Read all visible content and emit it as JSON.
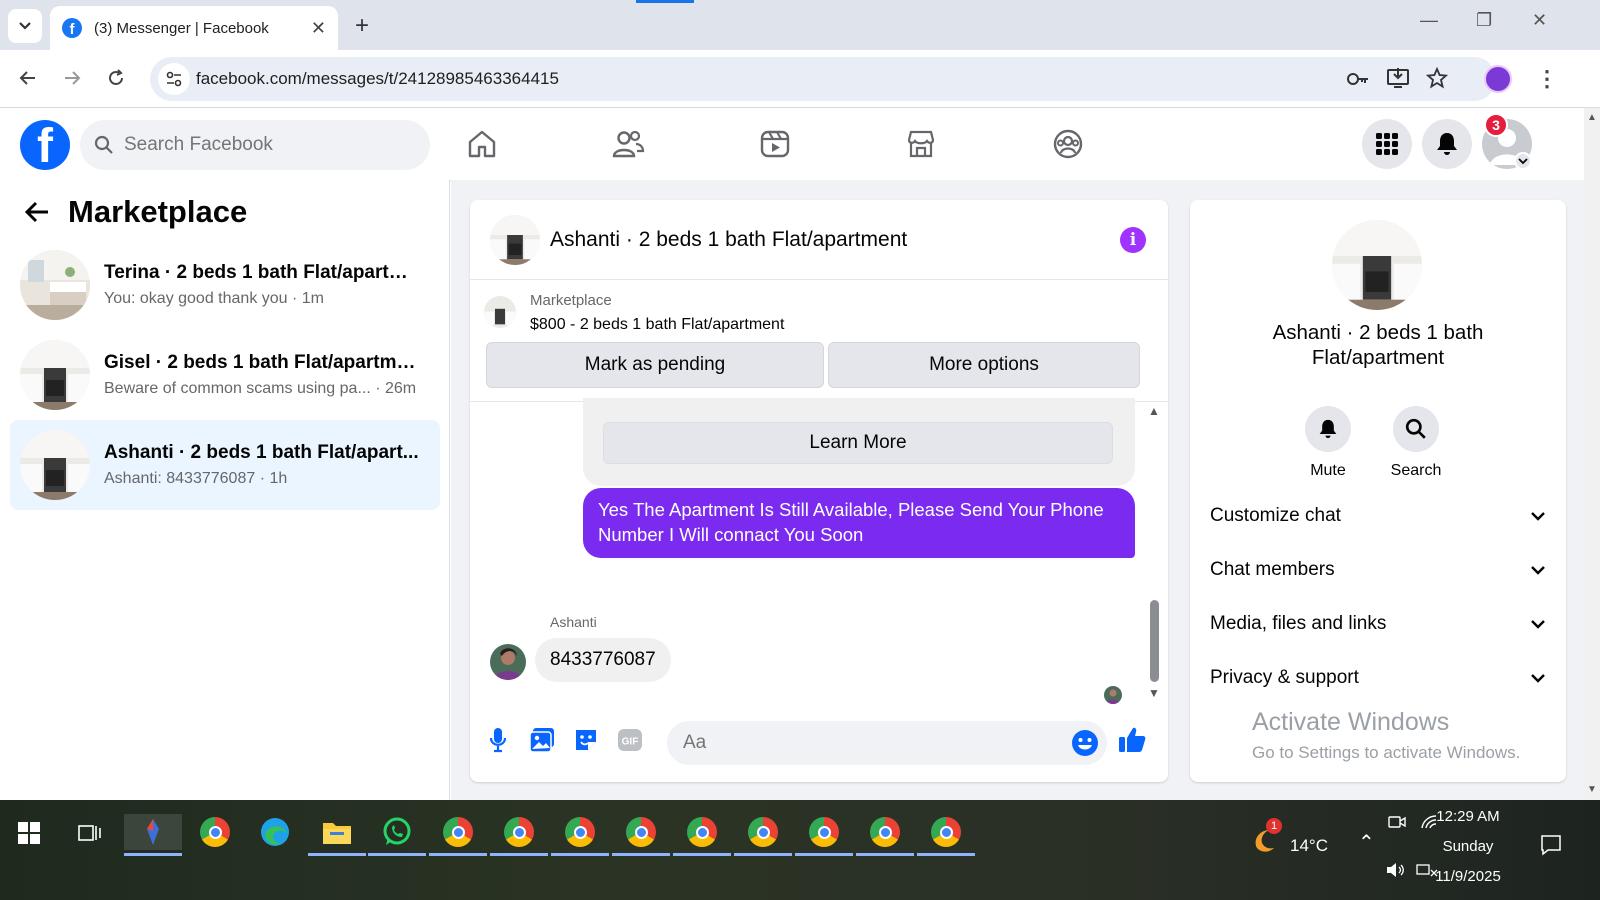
{
  "browser": {
    "tab_title": "(3) Messenger | Facebook",
    "tab_favicon": "f",
    "url": "facebook.com/messages/t/24128985463364415"
  },
  "facebook": {
    "logo": "f",
    "search_placeholder": "Search Facebook",
    "notification_count": "3",
    "nav_icons": [
      "home-icon",
      "friends-icon",
      "watch-icon",
      "marketplace-icon",
      "groups-icon"
    ]
  },
  "left_panel": {
    "title": "Marketplace",
    "conversations": [
      {
        "name": "Terina · 2 beds 1 bath Flat/apartme...",
        "preview": "You: okay good thank you · 1m"
      },
      {
        "name": "Gisel · 2 beds 1 bath Flat/apartment",
        "preview": "Beware of common scams using pa...  · 26m"
      },
      {
        "name": "Ashanti · 2 beds 1 bath Flat/apart...",
        "preview": "Ashanti: 8433776087 · 1h"
      }
    ]
  },
  "chat": {
    "title": "Ashanti · 2 beds 1 bath Flat/apartment",
    "marketplace_label": "Marketplace",
    "marketplace_item": "$800 - 2 beds 1 bath Flat/apartment",
    "mark_pending": "Mark as pending",
    "more_options": "More options",
    "learn_more": "Learn More",
    "outgoing_message": "Yes The Apartment Is Still Available, Please Send Your Phone Number I Will connact You Soon",
    "sender_name": "Ashanti",
    "incoming_message": "8433776087",
    "composer_placeholder": "Aa"
  },
  "info_panel": {
    "title": "Ashanti · 2 beds 1 bath Flat/apartment",
    "mute": "Mute",
    "search": "Search",
    "sections": [
      "Customize chat",
      "Chat members",
      "Media, files and links",
      "Privacy & support"
    ]
  },
  "watermark": {
    "line1": "Activate Windows",
    "line2": "Go to Settings to activate Windows."
  },
  "taskbar": {
    "weather": "14°C",
    "weather_badge": "1",
    "time": "12:29 AM",
    "day": "Sunday",
    "date": "11/9/2025"
  },
  "colors": {
    "fb_blue": "#0866ff",
    "outgoing_bubble": "#7b2bf0",
    "info_purple": "#a033ff",
    "active_conv": "#ebf5ff"
  }
}
